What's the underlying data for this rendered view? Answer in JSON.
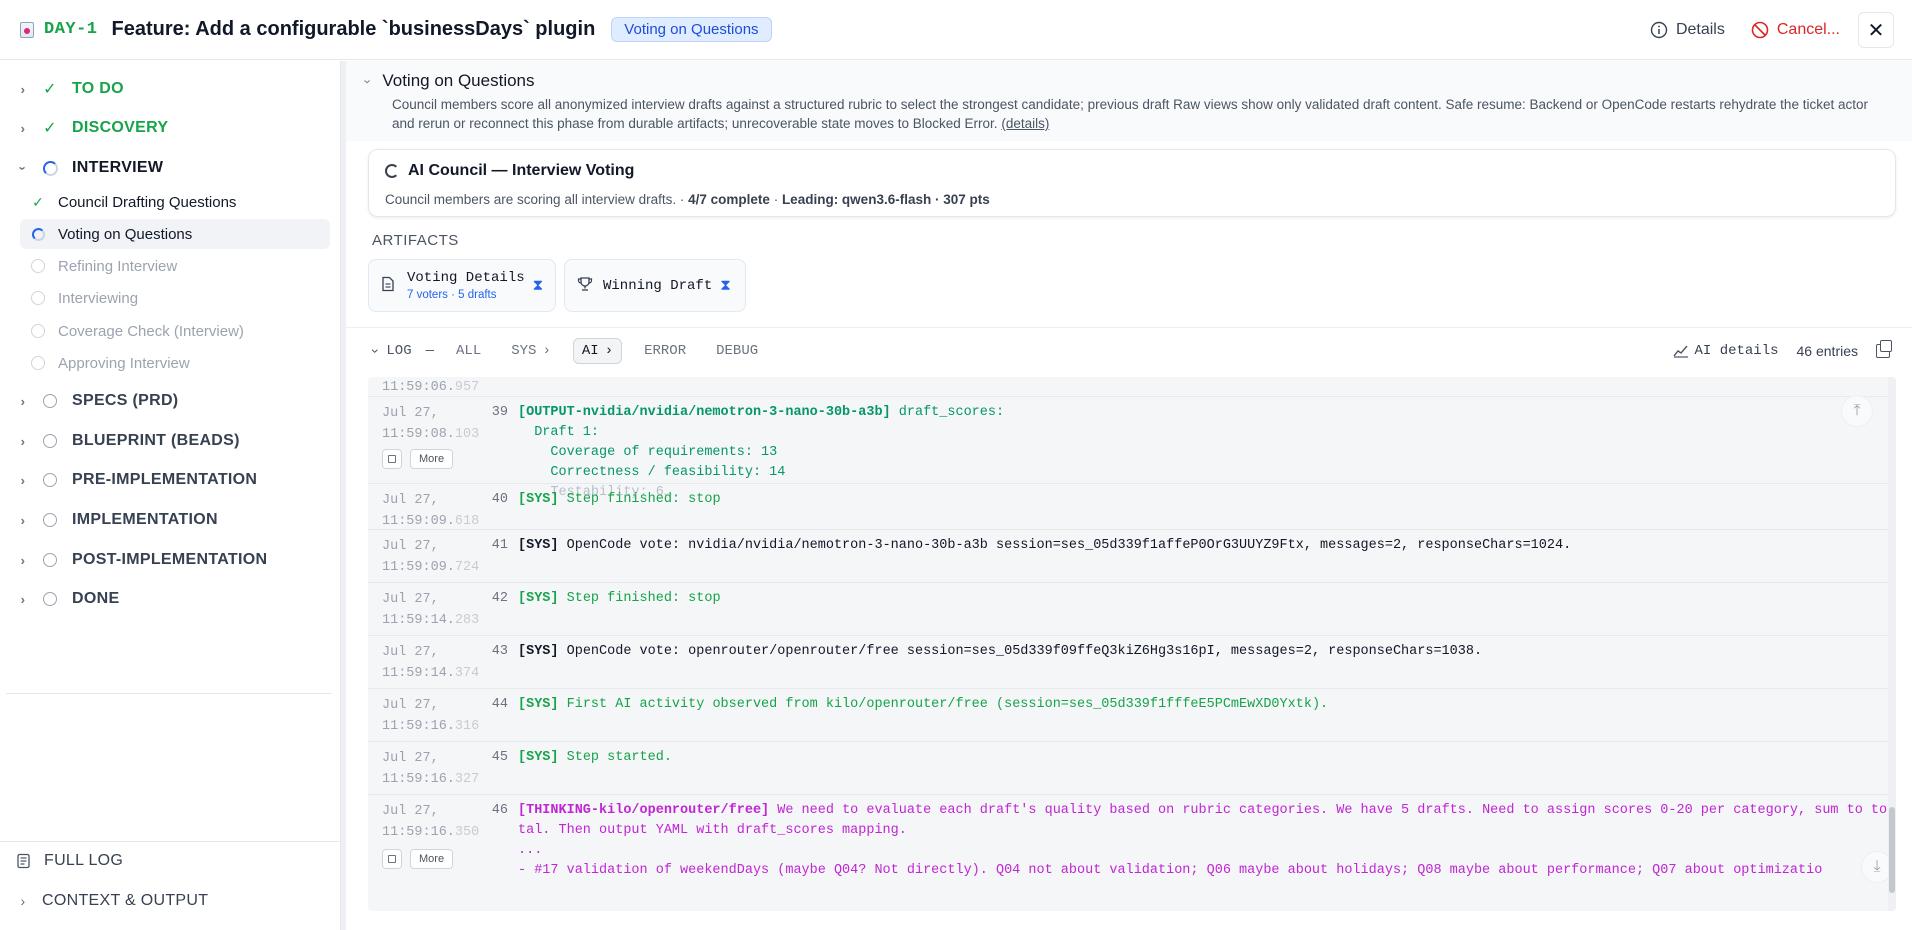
{
  "header": {
    "ticket_id": "DAY-1",
    "title": "Feature: Add a configurable `businessDays` plugin",
    "phase_badge": "Voting on Questions",
    "details_label": "Details",
    "cancel_label": "Cancel...",
    "close_symbol": "✕"
  },
  "sidebar": {
    "phases": [
      {
        "label": "TO DO",
        "status": "done",
        "expanded": false
      },
      {
        "label": "DISCOVERY",
        "status": "done",
        "expanded": false
      },
      {
        "label": "INTERVIEW",
        "status": "active",
        "expanded": true
      },
      {
        "label": "SPECS (PRD)",
        "status": "pending",
        "expanded": false
      },
      {
        "label": "BLUEPRINT (BEADS)",
        "status": "pending",
        "expanded": false
      },
      {
        "label": "PRE-IMPLEMENTATION",
        "status": "pending",
        "expanded": false
      },
      {
        "label": "IMPLEMENTATION",
        "status": "pending",
        "expanded": false
      },
      {
        "label": "POST-IMPLEMENTATION",
        "status": "pending",
        "expanded": false
      },
      {
        "label": "DONE",
        "status": "pending",
        "expanded": false
      }
    ],
    "interview_steps": [
      {
        "label": "Council Drafting Questions",
        "status": "done"
      },
      {
        "label": "Voting on Questions",
        "status": "active"
      },
      {
        "label": "Refining Interview",
        "status": "pending"
      },
      {
        "label": "Interviewing",
        "status": "pending"
      },
      {
        "label": "Coverage Check (Interview)",
        "status": "pending"
      },
      {
        "label": "Approving Interview",
        "status": "pending"
      }
    ],
    "full_log_label": "FULL LOG",
    "context_output_label": "CONTEXT & OUTPUT"
  },
  "main": {
    "phase_title": "Voting on Questions",
    "phase_description": "Council members score all anonymized interview drafts against a structured rubric to select the strongest candidate; previous draft Raw views show only validated draft content. Safe resume: Backend or OpenCode restarts rehydrate the ticket actor and rerun or reconnect this phase from durable artifacts; unrecoverable state moves to Blocked Error.",
    "details_link": "(details)",
    "council": {
      "title": "AI Council — Interview Voting",
      "subtitle_prefix": "Council members are scoring all interview drafts. ·",
      "progress": "4/7 complete",
      "leading": "Leading: qwen3.6-flash",
      "points": "· 307 pts"
    },
    "artifacts_label": "ARTIFACTS",
    "artifacts": [
      {
        "label": "Voting Details",
        "meta": "7 voters · 5 drafts",
        "icon": "document-icon"
      },
      {
        "label": "Winning Draft",
        "meta": "",
        "icon": "trophy-icon"
      }
    ],
    "log": {
      "toggle_label": "LOG",
      "separator": "—",
      "tabs": [
        "ALL",
        "SYS",
        "AI",
        "ERROR",
        "DEBUG"
      ],
      "selected_tab": "AI",
      "ai_details_label": "AI details",
      "entries_count": "46 entries",
      "more_label": "More",
      "rows": [
        {
          "date": "",
          "time": "11:59:06.",
          "ms": "957",
          "num": "",
          "tag": "",
          "text": ""
        },
        {
          "date": "Jul 27,",
          "time": "11:59:08.",
          "ms": "103",
          "num": "39",
          "tag": "[OUTPUT-nvidia/nvidia/nemotron-3-nano-30b-a3b]",
          "text": " draft_scores:\n  Draft 1:\n    Coverage of requirements: 13\n    Correctness / feasibility: 14",
          "fade": "    Testability: 6…"
        },
        {
          "date": "Jul 27,",
          "time": "11:59:09.",
          "ms": "618",
          "num": "40",
          "tag": "[SYS]",
          "text": " Step finished: stop"
        },
        {
          "date": "Jul 27,",
          "time": "11:59:09.",
          "ms": "724",
          "num": "41",
          "tag": "[SYS]",
          "text": " OpenCode vote: nvidia/nvidia/nemotron-3-nano-30b-a3b session=ses_05d339f1affeP0OrG3UUYZ9Ftx, messages=2, responseChars=1024."
        },
        {
          "date": "Jul 27,",
          "time": "11:59:14.",
          "ms": "283",
          "num": "42",
          "tag": "[SYS]",
          "text": " Step finished: stop"
        },
        {
          "date": "Jul 27,",
          "time": "11:59:14.",
          "ms": "374",
          "num": "43",
          "tag": "[SYS]",
          "text": " OpenCode vote: openrouter/openrouter/free session=ses_05d339f09ffeQ3kiZ6Hg3s16pI, messages=2, responseChars=1038."
        },
        {
          "date": "Jul 27,",
          "time": "11:59:16.",
          "ms": "316",
          "num": "44",
          "tag": "[SYS]",
          "text": " First AI activity observed from kilo/openrouter/free (session=ses_05d339f1fffeE5PCmEwXD0Yxtk)."
        },
        {
          "date": "Jul 27,",
          "time": "11:59:16.",
          "ms": "327",
          "num": "45",
          "tag": "[SYS]",
          "text": " Step started."
        },
        {
          "date": "Jul 27,",
          "time": "11:59:16.",
          "ms": "350",
          "num": "46",
          "tag": "[THINKING-kilo/openrouter/free]",
          "text": " We need to evaluate each draft's quality based on rubric categories. We have 5 drafts. Need to assign scores 0-20 per category, sum to total. Then output YAML with draft_scores mapping.\n...\n- #17 validation of weekendDays (maybe Q04? Not directly). Q04 not about validation; Q06 maybe about holidays; Q08 maybe about performance; Q07 about optimizatio"
        }
      ]
    }
  },
  "colors": {
    "accent_green": "#16a34a",
    "accent_blue": "#2563eb",
    "danger": "#dc2626",
    "thinking": "#c026d3",
    "output": "#059669"
  }
}
